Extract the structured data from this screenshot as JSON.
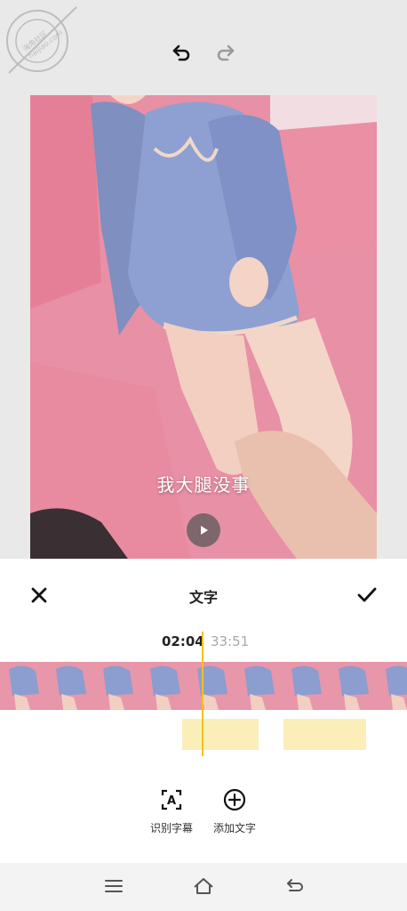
{
  "watermark": {
    "text": "海角社区 haijiao.com"
  },
  "toolbar": {
    "undo_icon": "undo-arrow",
    "redo_icon": "redo-arrow"
  },
  "video": {
    "subtitle": "我大腿没事",
    "play_icon": "play"
  },
  "editor": {
    "title": "文字",
    "close_icon": "x",
    "confirm_icon": "checkmark",
    "time_current": "02:04",
    "time_total": "33:51",
    "tools": [
      {
        "label": "识别字幕",
        "icon": "recognize-subtitles"
      },
      {
        "label": "添加文字",
        "icon": "add-circle"
      }
    ],
    "accent_color": "#f2c21b",
    "clip_color": "#fbeeb8"
  },
  "navbar": {
    "menu_icon": "menu",
    "home_icon": "home",
    "back_icon": "back"
  }
}
